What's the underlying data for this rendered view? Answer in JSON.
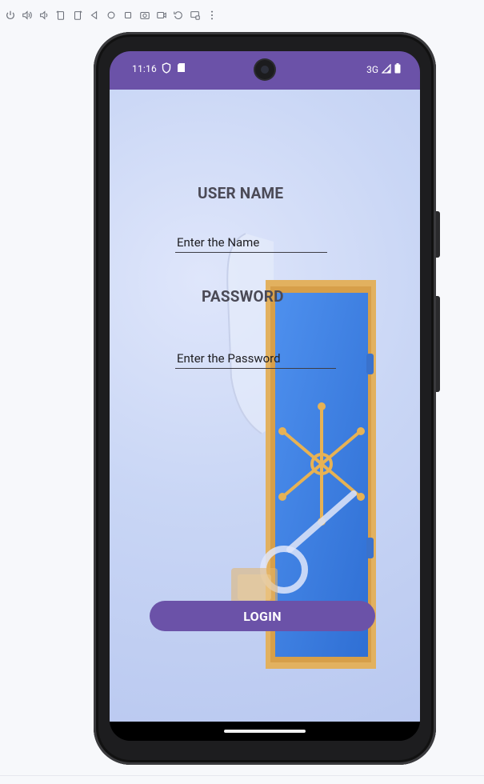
{
  "toolbar": {
    "icons": [
      "power-icon",
      "volume-up-icon",
      "volume-down-icon",
      "rotate-left-icon",
      "rotate-right-icon",
      "back-icon",
      "home-icon",
      "overview-icon",
      "camera-icon",
      "record-icon",
      "replay-icon",
      "fold-icon",
      "more-icon"
    ]
  },
  "status_bar": {
    "time": "11:16",
    "network": "3G"
  },
  "login_form": {
    "username_label": "USER NAME",
    "username_placeholder": "Enter the Name",
    "password_label": "PASSWORD",
    "password_placeholder": "Enter the Password",
    "login_label": "LOGIN"
  },
  "colors": {
    "accent": "#6b52a8",
    "label_text": "#4b4a56",
    "background": "#c9d6f5"
  }
}
